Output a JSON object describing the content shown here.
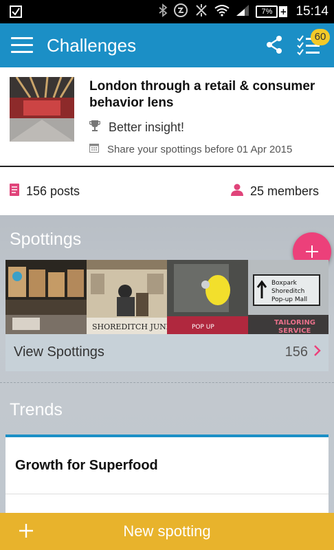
{
  "status_bar": {
    "time": "15:14",
    "battery": "7%"
  },
  "app_bar": {
    "title": "Challenges",
    "badge_count": "60",
    "accent": "#1b8fc6"
  },
  "challenge": {
    "title": "London through a retail & consumer behavior lens",
    "goal": "Better insight!",
    "deadline": "Share your spottings before 01 Apr 2015"
  },
  "stats": {
    "posts": "156 posts",
    "members": "25 members"
  },
  "spottings": {
    "heading": "Spottings",
    "view_label": "View Spottings",
    "count": "156",
    "photo_captions": [
      "SHOREDITCH JUNK",
      "Boxpark Shoreditch Pop-up Mall",
      "TAILORING SERVICE"
    ]
  },
  "trends": {
    "heading": "Trends",
    "first_item": "Growth for Superfood"
  },
  "bottom_bar": {
    "label": "New spotting",
    "color": "#e8b32c"
  },
  "icons": [
    "checkbox-icon",
    "bluetooth-icon",
    "data-saver-icon",
    "vibrate-off-icon",
    "wifi-icon",
    "signal-icon",
    "battery-icon",
    "menu-icon",
    "share-icon",
    "checklist-icon",
    "trophy-icon",
    "calendar-icon",
    "posts-icon",
    "person-icon",
    "add-icon",
    "chevron-right-icon"
  ]
}
